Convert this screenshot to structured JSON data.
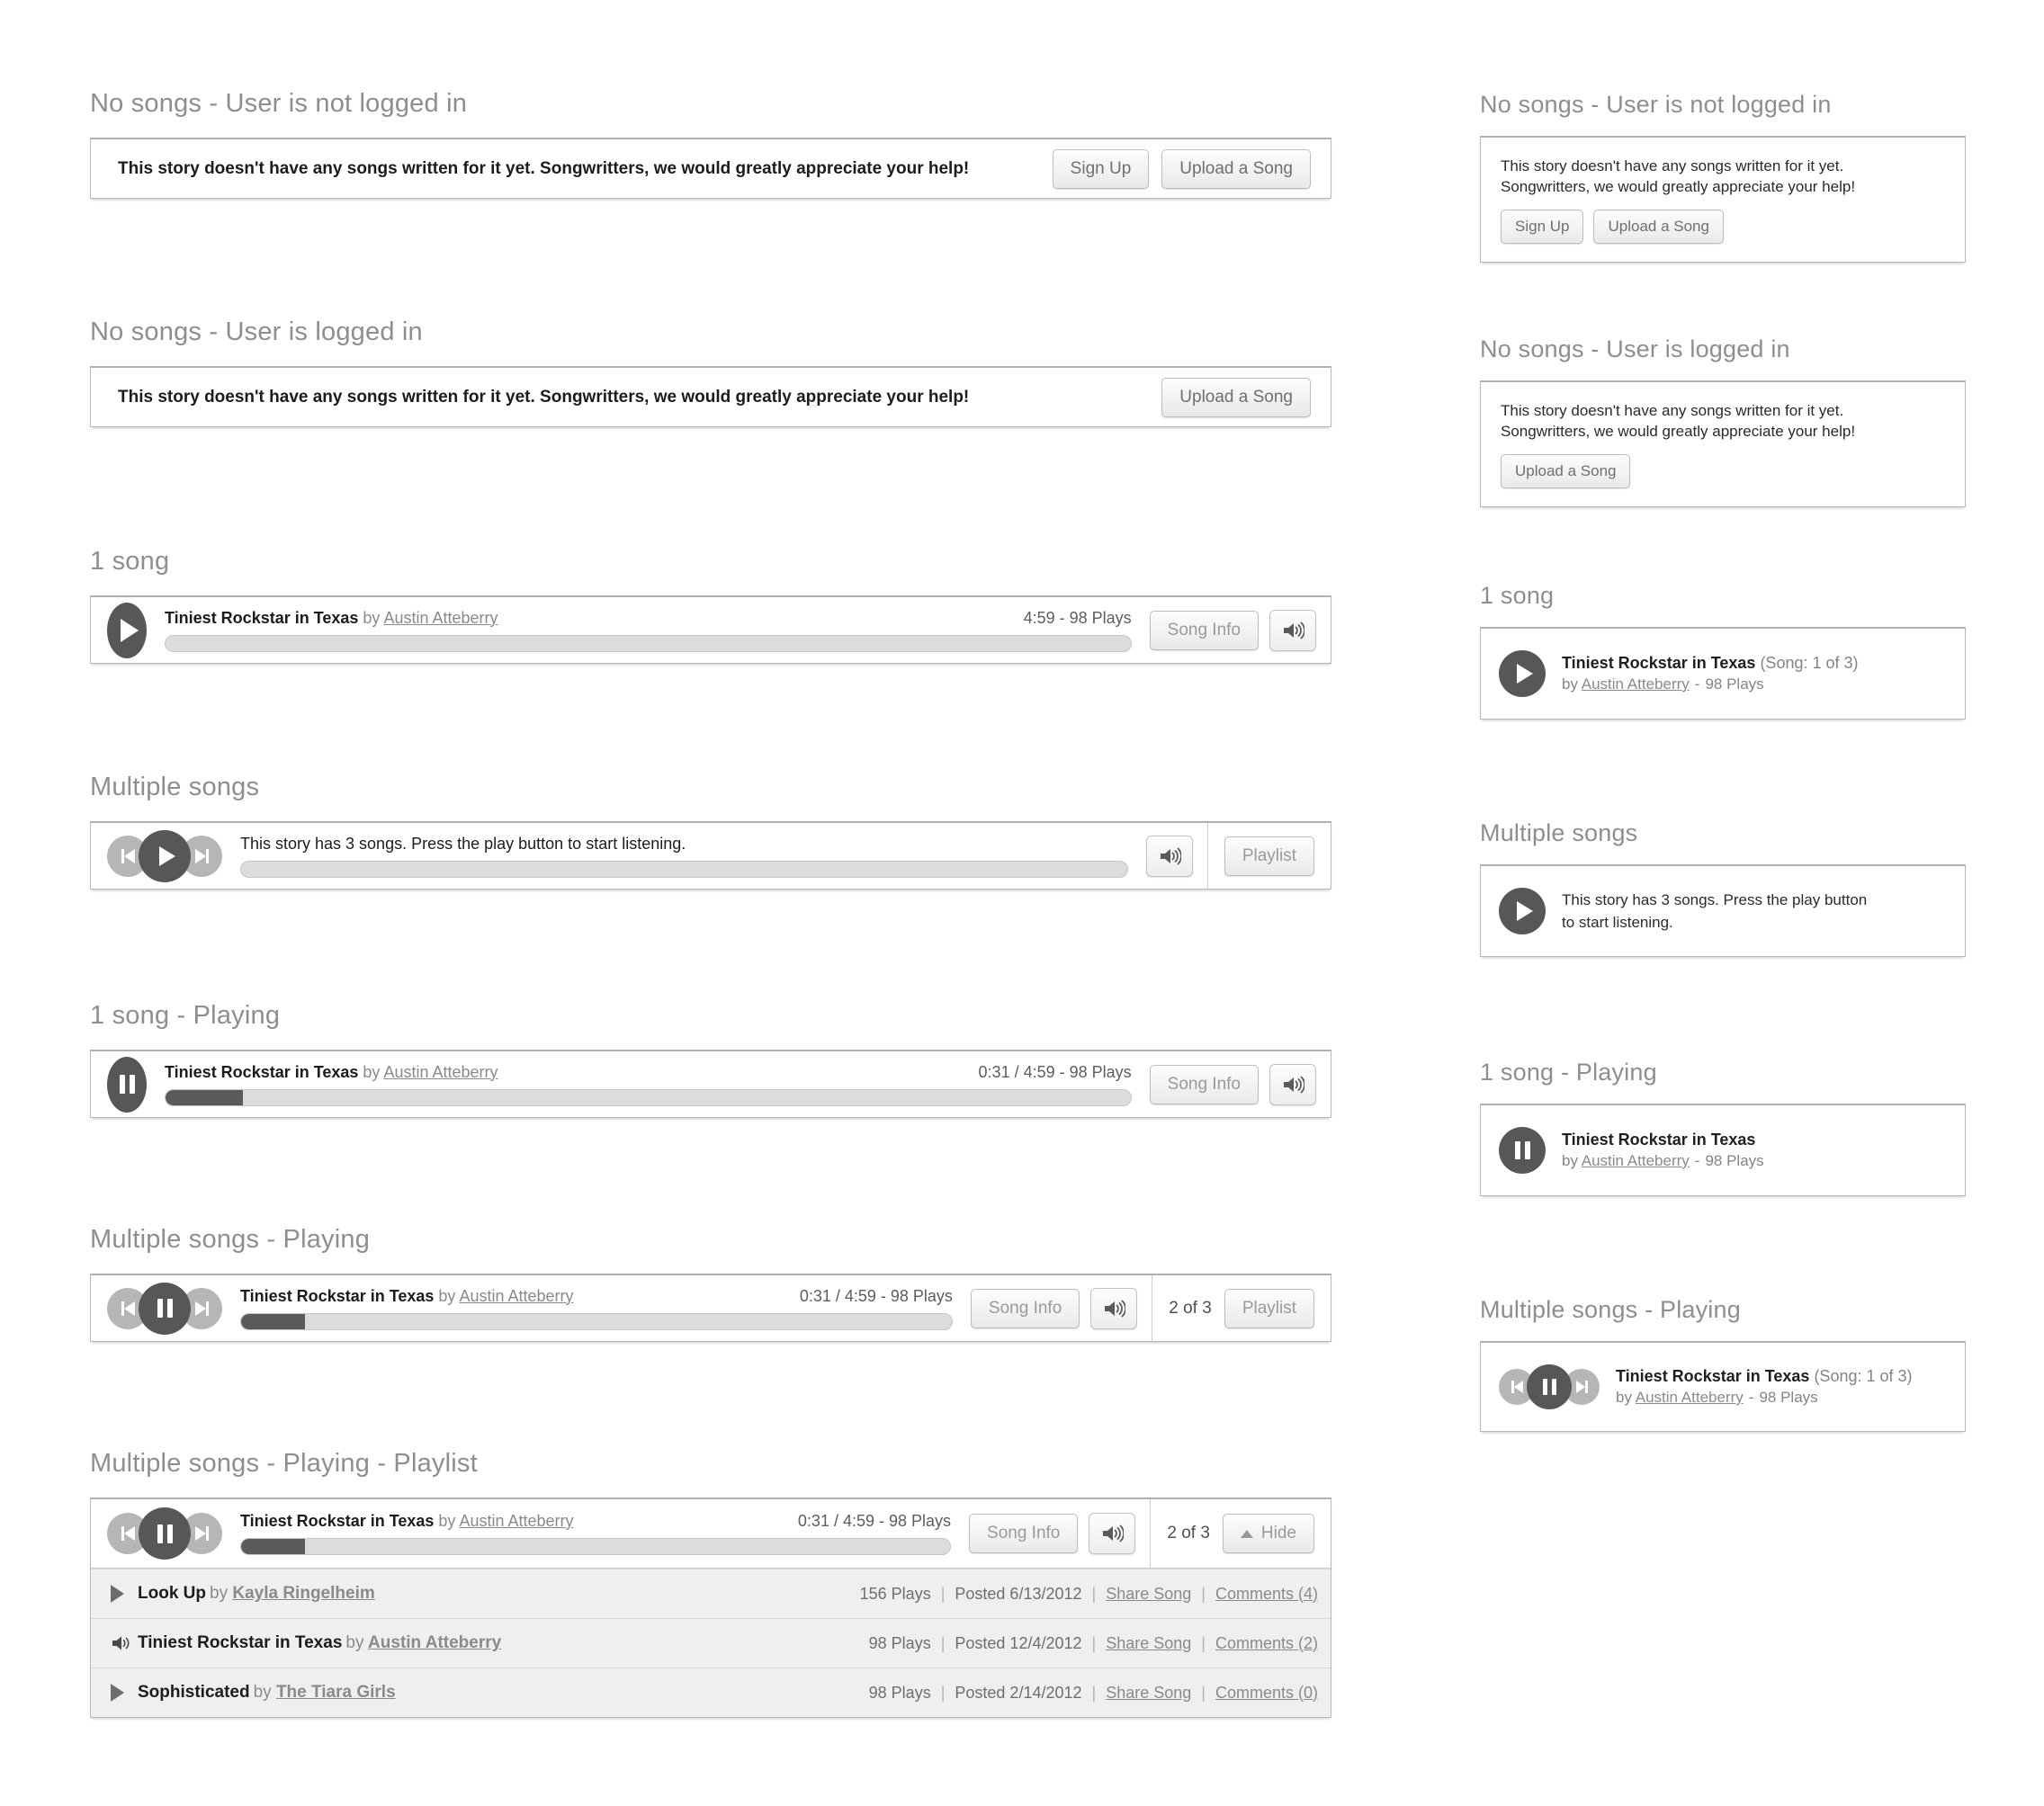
{
  "strings": {
    "empty_message_one_line": "This story doesn't have any songs written for it yet. Songwritters, we would greatly appreciate your help!",
    "empty_message_wrapped_line1": "This story doesn't have any songs written for it yet.",
    "empty_message_wrapped_line2": "Songwritters, we would greatly appreciate your help!",
    "sign_up": "Sign Up",
    "upload_a_song": "Upload a Song",
    "song_info": "Song Info",
    "playlist": "Playlist",
    "hide": "Hide",
    "by": "by",
    "dash": "-",
    "multi_prompt": "This story has 3 songs. Press the play button to start listening.",
    "multi_prompt_line1": "This story has 3 songs. Press the play button",
    "multi_prompt_line2": "to start listening."
  },
  "left": {
    "sections": [
      {
        "id": "no-songs-logged-out",
        "title": "No songs - User is not logged in"
      },
      {
        "id": "no-songs-logged-in",
        "title": "No songs - User is logged in"
      },
      {
        "id": "one-song",
        "title": "1 song"
      },
      {
        "id": "multiple-songs",
        "title": "Multiple songs"
      },
      {
        "id": "one-song-playing",
        "title": "1 song - Playing"
      },
      {
        "id": "multiple-playing",
        "title": "Multiple songs - Playing"
      },
      {
        "id": "multiple-playlist",
        "title": "Multiple songs - Playing - Playlist"
      }
    ],
    "one_song": {
      "track": "Tiniest Rockstar in Texas",
      "artist": "Austin Atteberry",
      "meta": "4:59 - 98 Plays",
      "progress_percent": 0
    },
    "one_song_playing": {
      "track": "Tiniest Rockstar in Texas",
      "artist": "Austin Atteberry",
      "meta": "0:31 / 4:59 - 98 Plays",
      "progress_percent": 8
    },
    "multiple": {
      "prompt": "This story has 3 songs. Press the play button to start listening.",
      "progress_percent": 0
    },
    "multiple_playing": {
      "track": "Tiniest Rockstar in Texas",
      "artist": "Austin Atteberry",
      "meta": "0:31 / 4:59 - 98 Plays",
      "count": "2 of 3",
      "progress_percent": 9
    },
    "multiple_playlist": {
      "track": "Tiniest Rockstar in Texas",
      "artist": "Austin Atteberry",
      "meta": "0:31 / 4:59 - 98 Plays",
      "count": "2 of 3",
      "progress_percent": 9,
      "rows": [
        {
          "icon": "play-icon",
          "title": "Look Up",
          "artist": "Kayla Ringelheim",
          "plays": "156 Plays",
          "posted": "Posted 6/13/2012",
          "share": "Share Song",
          "comments": "Comments (4)"
        },
        {
          "icon": "speaker-icon",
          "title": "Tiniest Rockstar in Texas",
          "artist": "Austin Atteberry",
          "plays": "98 Plays",
          "posted": "Posted 12/4/2012",
          "share": "Share Song",
          "comments": "Comments (2)"
        },
        {
          "icon": "play-icon",
          "title": "Sophisticated",
          "artist": "The Tiara Girls",
          "plays": "98 Plays",
          "posted": "Posted 2/14/2012",
          "share": "Share Song",
          "comments": "Comments (0)"
        }
      ]
    }
  },
  "right": {
    "sections": [
      {
        "id": "r-no-songs-logged-out",
        "title": "No songs - User is not logged in"
      },
      {
        "id": "r-no-songs-logged-in",
        "title": "No songs - User is logged in"
      },
      {
        "id": "r-one-song",
        "title": "1 song"
      },
      {
        "id": "r-multiple-songs",
        "title": "Multiple songs"
      },
      {
        "id": "r-one-song-playing",
        "title": "1 song - Playing"
      },
      {
        "id": "r-multiple-playing",
        "title": "Multiple songs - Playing"
      }
    ],
    "one_song": {
      "track": "Tiniest Rockstar in Texas",
      "song_counter": "(Song: 1 of 3)",
      "artist": "Austin Atteberry",
      "plays": "98 Plays"
    },
    "one_song_playing": {
      "track": "Tiniest Rockstar in Texas",
      "artist": "Austin Atteberry",
      "plays": "98 Plays"
    },
    "multiple_playing": {
      "track": "Tiniest Rockstar in Texas",
      "song_counter": "(Song: 1 of 3)",
      "artist": "Austin Atteberry",
      "plays": "98 Plays"
    }
  },
  "colors": {
    "page_bg": "#ffffff",
    "heading": "#8e8e8e",
    "card_border": "#b8b8b8",
    "transport_dark": "#575757",
    "transport_light": "#b6b6b6",
    "progress_fill": "#5a5a5a",
    "progress_track": "#dcdcdc",
    "row_bg": "#efefef",
    "link": "#8a8a8a"
  }
}
